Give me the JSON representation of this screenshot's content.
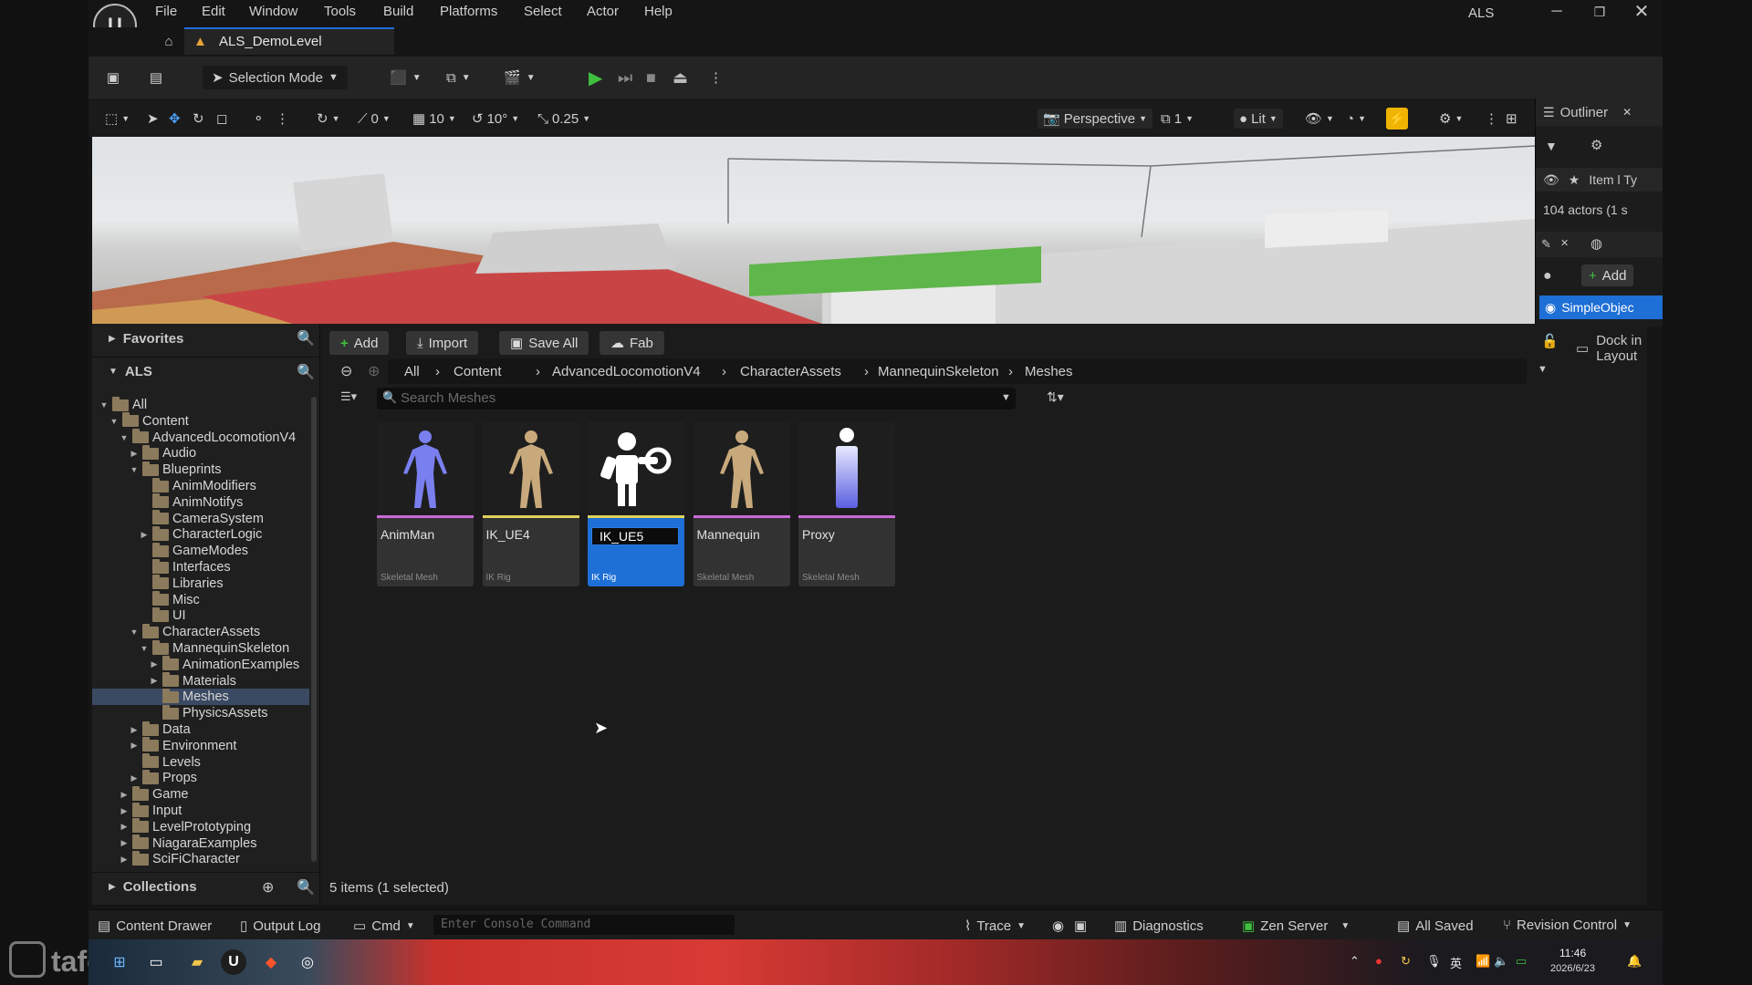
{
  "window": {
    "project_name": "ALS",
    "level_tab": "ALS_DemoLevel"
  },
  "menu": [
    "File",
    "Edit",
    "Window",
    "Tools",
    "Build",
    "Platforms",
    "Select",
    "Actor",
    "Help"
  ],
  "toolbar": {
    "selection_mode": "Selection Mode"
  },
  "viewport_bar": {
    "angle_value": "0",
    "grid_value": "10",
    "rotate_value": "10°",
    "scale_value": "0.25",
    "perspective": "Perspective",
    "layers_value": "1",
    "lit": "Lit"
  },
  "outliner": {
    "title": "Outliner",
    "column_label": "Item l Ty",
    "actors_count": "104 actors (1 s",
    "add_label": "Add",
    "selected_item": "SimpleObjec"
  },
  "sources": {
    "favorites": "Favorites",
    "project": "ALS",
    "collections": "Collections",
    "tree": [
      {
        "label": "All",
        "depth": 0,
        "arrow": "open"
      },
      {
        "label": "Content",
        "depth": 1,
        "arrow": "open"
      },
      {
        "label": "AdvancedLocomotionV4",
        "depth": 2,
        "arrow": "open"
      },
      {
        "label": "Audio",
        "depth": 3,
        "arrow": "closed"
      },
      {
        "label": "Blueprints",
        "depth": 3,
        "arrow": "open"
      },
      {
        "label": "AnimModifiers",
        "depth": 4,
        "arrow": "none"
      },
      {
        "label": "AnimNotifys",
        "depth": 4,
        "arrow": "none"
      },
      {
        "label": "CameraSystem",
        "depth": 4,
        "arrow": "none"
      },
      {
        "label": "CharacterLogic",
        "depth": 4,
        "arrow": "closed"
      },
      {
        "label": "GameModes",
        "depth": 4,
        "arrow": "none"
      },
      {
        "label": "Interfaces",
        "depth": 4,
        "arrow": "none"
      },
      {
        "label": "Libraries",
        "depth": 4,
        "arrow": "none"
      },
      {
        "label": "Misc",
        "depth": 4,
        "arrow": "none"
      },
      {
        "label": "UI",
        "depth": 4,
        "arrow": "none"
      },
      {
        "label": "CharacterAssets",
        "depth": 3,
        "arrow": "open"
      },
      {
        "label": "MannequinSkeleton",
        "depth": 4,
        "arrow": "open"
      },
      {
        "label": "AnimationExamples",
        "depth": 5,
        "arrow": "closed"
      },
      {
        "label": "Materials",
        "depth": 5,
        "arrow": "closed"
      },
      {
        "label": "Meshes",
        "depth": 5,
        "arrow": "none",
        "selected": true
      },
      {
        "label": "PhysicsAssets",
        "depth": 5,
        "arrow": "none"
      },
      {
        "label": "Data",
        "depth": 3,
        "arrow": "closed"
      },
      {
        "label": "Environment",
        "depth": 3,
        "arrow": "closed"
      },
      {
        "label": "Levels",
        "depth": 3,
        "arrow": "none"
      },
      {
        "label": "Props",
        "depth": 3,
        "arrow": "closed"
      },
      {
        "label": "Game",
        "depth": 2,
        "arrow": "closed"
      },
      {
        "label": "Input",
        "depth": 2,
        "arrow": "closed"
      },
      {
        "label": "LevelPrototyping",
        "depth": 2,
        "arrow": "closed"
      },
      {
        "label": "NiagaraExamples",
        "depth": 2,
        "arrow": "closed"
      },
      {
        "label": "SciFiCharacter",
        "depth": 2,
        "arrow": "closed"
      }
    ]
  },
  "assets": {
    "add": "Add",
    "import": "Import",
    "save_all": "Save All",
    "fab": "Fab",
    "dock_in_layout": "Dock in Layout",
    "breadcrumbs": [
      "All",
      "Content",
      "AdvancedLocomotionV4",
      "CharacterAssets",
      "MannequinSkeleton",
      "Meshes"
    ],
    "search_placeholder": "Search Meshes",
    "items": [
      {
        "name": "AnimMan",
        "type": "Skeletal Mesh",
        "bar_color": "#c86bd6",
        "selected": false
      },
      {
        "name": "IK_UE4",
        "type": "IK Rig",
        "bar_color": "#e0d25a",
        "selected": false
      },
      {
        "name": "IK_UE5",
        "type": "IK Rig",
        "bar_color": "#e0d25a",
        "selected": true
      },
      {
        "name": "Mannequin",
        "type": "Skeletal Mesh",
        "bar_color": "#c86bd6",
        "selected": false
      },
      {
        "name": "Proxy",
        "type": "Skeletal Mesh",
        "bar_color": "#c86bd6",
        "selected": false
      }
    ],
    "status": "5 items (1 selected)"
  },
  "statusbar": {
    "content_drawer": "Content Drawer",
    "output_log": "Output Log",
    "cmd": "Cmd",
    "console_placeholder": "Enter Console Command",
    "trace": "Trace",
    "diagnostics": "Diagnostics",
    "zen_server": "Zen Server",
    "all_saved": "All Saved",
    "revision_control": "Revision Control"
  },
  "taskbar": {
    "time": "11:46",
    "date": "2026/6/23",
    "ime": "英"
  },
  "watermark": "tafecc",
  "colors": {
    "accent_blue": "#1e6fd6",
    "play_green": "#3fbf3f",
    "folder": "#8b7a5c",
    "skeletal_mesh_bar": "#c86bd6",
    "ik_rig_bar": "#e0d25a"
  }
}
